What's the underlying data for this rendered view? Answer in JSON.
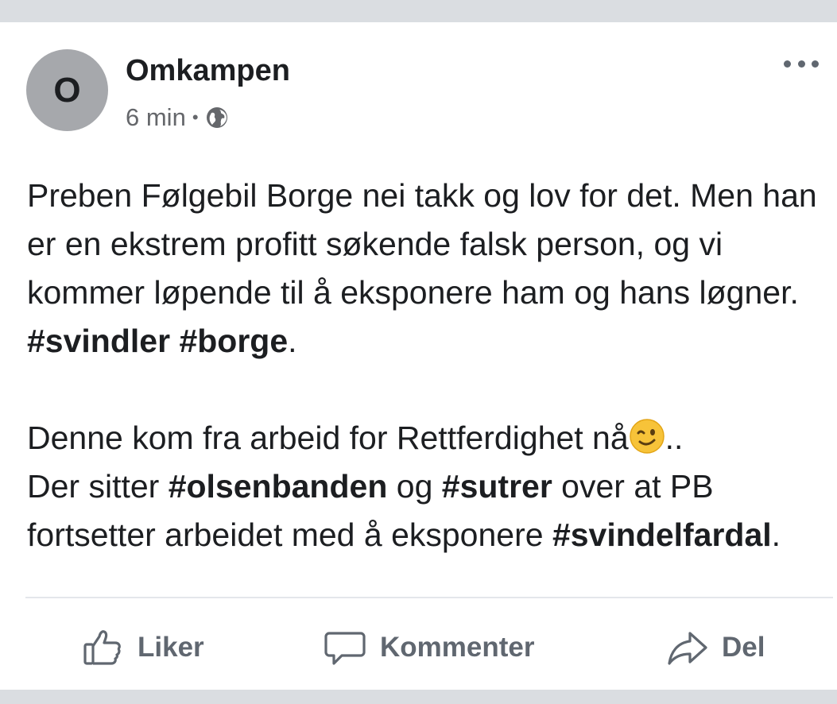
{
  "post": {
    "avatar_letter": "O",
    "author": "Omkampen",
    "time": "6 min",
    "separator": "•",
    "privacy_icon": "globe-icon",
    "more_icon": "more-options-icon",
    "paragraph1": {
      "text": "Preben Følgebil Borge nei takk og lov for det. Men han er en ekstrem profitt søkende falsk person, og vi kommer løpende til å eksponere ham og hans løgner. ",
      "tag1": "#svindler",
      "space": " ",
      "tag2": "#borge",
      "end": "."
    },
    "paragraph2": {
      "line1": "Denne kom fra arbeid for Rettferdighet nå",
      "emoji": "winking-face-icon",
      "line1_end": "..",
      "line2_a": "Der sitter ",
      "tag_olsenbanden": "#olsenbanden",
      "line2_b": " og ",
      "tag_sutrer": "#sutrer",
      "line2_c": " over at PB fortsetter arbeidet med å eksponere ",
      "tag_svindelfardal": "#svindelfardal",
      "end": "."
    }
  },
  "actions": {
    "like": "Liker",
    "comment": "Kommenter",
    "share": "Del"
  },
  "colors": {
    "background": "#dadde1",
    "card": "#ffffff",
    "text": "#1c1e21",
    "muted": "#65676b",
    "action": "#606770",
    "avatar": "#a6a8ac"
  }
}
